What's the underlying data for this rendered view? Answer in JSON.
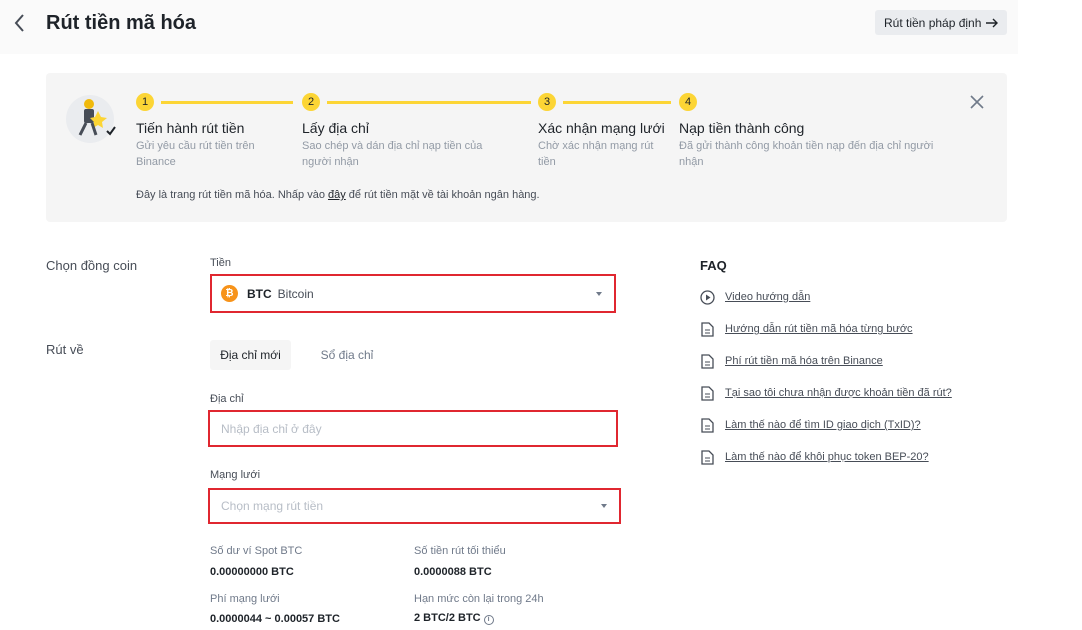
{
  "header": {
    "title": "Rút tiền mã hóa",
    "fiat_button": "Rút tiền pháp định"
  },
  "steps": [
    {
      "number": "1",
      "title": "Tiến hành rút tiền",
      "desc": "Gửi yêu cầu rút tiền trên Binance"
    },
    {
      "number": "2",
      "title": "Lấy địa chỉ",
      "desc": "Sao chép và dán địa chỉ nạp tiền của người nhận"
    },
    {
      "number": "3",
      "title": "Xác nhận mạng lưới",
      "desc": "Chờ xác nhận mạng rút tiền"
    },
    {
      "number": "4",
      "title": "Nạp tiền thành công",
      "desc": "Đã gửi thành công khoản tiền nạp đến địa chỉ người nhận"
    }
  ],
  "note": {
    "before": "Đây là trang rút tiền mã hóa. Nhấp vào ",
    "link": "đây",
    "after": " để rút tiền mặt về tài khoản ngân hàng."
  },
  "form": {
    "choose_coin_label": "Chọn đồng coin",
    "coin_field_label": "Tiền",
    "coin_icon": "btc-icon",
    "coin_icon_glyph": "₿",
    "coin_symbol": "BTC",
    "coin_name": "Bitcoin",
    "withdraw_to_label": "Rút về",
    "tabs": [
      "Địa chỉ mới",
      "Sổ địa chỉ"
    ],
    "address_label": "Địa chỉ",
    "address_placeholder": "Nhập địa chỉ ở đây",
    "network_label": "Mạng lưới",
    "network_placeholder": "Chọn mạng rút tiền",
    "stats": {
      "spot_balance_label": "Số dư ví Spot BTC",
      "spot_balance_value": "0.00000000 BTC",
      "min_withdraw_label": "Số tiền rút tối thiểu",
      "min_withdraw_value": "0.0000088 BTC",
      "network_fee_label": "Phí mạng lưới",
      "network_fee_value": "0.0000044 ~ 0.00057 BTC",
      "limit_label": "Hạn mức còn lại trong 24h",
      "limit_value": "2 BTC/2 BTC"
    }
  },
  "faq": {
    "title": "FAQ",
    "items": [
      {
        "icon": "play-circle-icon",
        "text": "Video hướng dẫn"
      },
      {
        "icon": "document-icon",
        "text": "Hướng dẫn rút tiền mã hóa từng bước"
      },
      {
        "icon": "document-icon",
        "text": "Phí rút tiền mã hóa trên Binance"
      },
      {
        "icon": "document-icon",
        "text": "Tại sao tôi chưa nhận được khoản tiền đã rút?"
      },
      {
        "icon": "document-icon",
        "text": "Làm thế nào để tìm ID giao dịch (TxID)?"
      },
      {
        "icon": "document-icon",
        "text": "Làm thế nào để khôi phục token BEP-20?"
      }
    ]
  },
  "colors": {
    "accent": "#fcd535",
    "highlight_border": "#e02730",
    "btc": "#f7931a"
  }
}
